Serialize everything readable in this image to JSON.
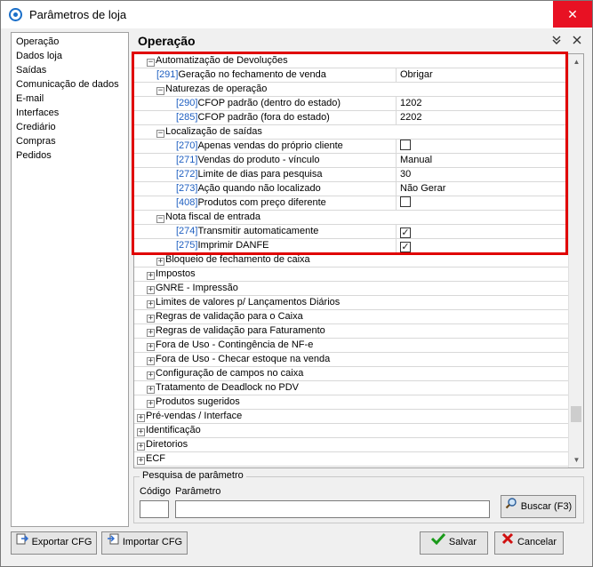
{
  "window": {
    "title": "Parâmetros de loja",
    "close_glyph": "✕"
  },
  "sidebar": {
    "items": [
      {
        "label": "Operação"
      },
      {
        "label": "Dados loja"
      },
      {
        "label": "Saídas"
      },
      {
        "label": "Comunicação de dados"
      },
      {
        "label": "E-mail"
      },
      {
        "label": "Interfaces"
      },
      {
        "label": "Crediário"
      },
      {
        "label": "Compras"
      },
      {
        "label": "Pedidos"
      }
    ]
  },
  "panel": {
    "title": "Operação",
    "collapse_icon": "chevron-double-down-icon",
    "close_icon": "close-icon"
  },
  "grid": {
    "rows": [
      {
        "level": 1,
        "group": true,
        "expanded": true,
        "label": "Automatização de Devoluções"
      },
      {
        "level": 2,
        "id": "[291]",
        "label": "Geração no fechamento de venda",
        "value": "Obrigar"
      },
      {
        "level": 2,
        "group": true,
        "expanded": true,
        "label": "Naturezas de operação"
      },
      {
        "level": 3,
        "id": "[290]",
        "label": "CFOP padrão (dentro do estado)",
        "value": "1202"
      },
      {
        "level": 3,
        "id": "[285]",
        "label": "CFOP padrão (fora do estado)",
        "value": "2202"
      },
      {
        "level": 2,
        "group": true,
        "expanded": true,
        "label": "Localização de saídas"
      },
      {
        "level": 3,
        "id": "[270]",
        "label": "Apenas vendas do próprio cliente",
        "checkbox": true,
        "checked": false
      },
      {
        "level": 3,
        "id": "[271]",
        "label": "Vendas do produto - vínculo",
        "value": "Manual"
      },
      {
        "level": 3,
        "id": "[272]",
        "label": "Limite de dias para pesquisa",
        "value": "30"
      },
      {
        "level": 3,
        "id": "[273]",
        "label": "Ação quando não localizado",
        "value": "Não Gerar"
      },
      {
        "level": 3,
        "id": "[408]",
        "label": "Produtos com preço diferente",
        "checkbox": true,
        "checked": false
      },
      {
        "level": 2,
        "group": true,
        "expanded": true,
        "label": "Nota fiscal de entrada"
      },
      {
        "level": 3,
        "id": "[274]",
        "label": "Transmitir automaticamente",
        "checkbox": true,
        "checked": true
      },
      {
        "level": 3,
        "id": "[275]",
        "label": "Imprimir DANFE",
        "checkbox": true,
        "checked": true
      },
      {
        "level": 2,
        "group": true,
        "expanded": false,
        "label": "Bloqueio de fechamento de caixa"
      },
      {
        "level": 1,
        "group": true,
        "expanded": false,
        "label": "Impostos"
      },
      {
        "level": 1,
        "group": true,
        "expanded": false,
        "label": "GNRE - Impressão"
      },
      {
        "level": 1,
        "group": true,
        "expanded": false,
        "label": "Limites de valores p/ Lançamentos Diários"
      },
      {
        "level": 1,
        "group": true,
        "expanded": false,
        "label": "Regras de validação para o Caixa"
      },
      {
        "level": 1,
        "group": true,
        "expanded": false,
        "label": "Regras de validação para Faturamento"
      },
      {
        "level": 1,
        "group": true,
        "expanded": false,
        "label": "Fora de Uso - Contingência de NF-e"
      },
      {
        "level": 1,
        "group": true,
        "expanded": false,
        "label": "Fora de Uso - Checar estoque na venda"
      },
      {
        "level": 1,
        "group": true,
        "expanded": false,
        "label": "Configuração de campos no caixa"
      },
      {
        "level": 1,
        "group": true,
        "expanded": false,
        "label": "Tratamento de Deadlock no PDV"
      },
      {
        "level": 1,
        "group": true,
        "expanded": false,
        "label": "Produtos sugeridos"
      },
      {
        "level": 0,
        "group": true,
        "expanded": false,
        "label": "Pré-vendas / Interface"
      },
      {
        "level": 0,
        "group": true,
        "expanded": false,
        "label": "Identificação"
      },
      {
        "level": 0,
        "group": true,
        "expanded": false,
        "label": "Diretorios"
      },
      {
        "level": 0,
        "group": true,
        "expanded": false,
        "label": "ECF"
      }
    ]
  },
  "search": {
    "legend": "Pesquisa de parâmetro",
    "code_label": "Código",
    "param_label": "Parâmetro",
    "code_value": "",
    "param_value": "",
    "button_label": "Buscar (F3)"
  },
  "footer": {
    "export_label": "Exportar CFG",
    "import_label": "Importar CFG",
    "save_label": "Salvar",
    "cancel_label": "Cancelar"
  },
  "colors": {
    "highlight": "#e00000",
    "param_id": "#1f5fc0",
    "save_check": "#1a9a1a",
    "cancel_x": "#d01010"
  }
}
